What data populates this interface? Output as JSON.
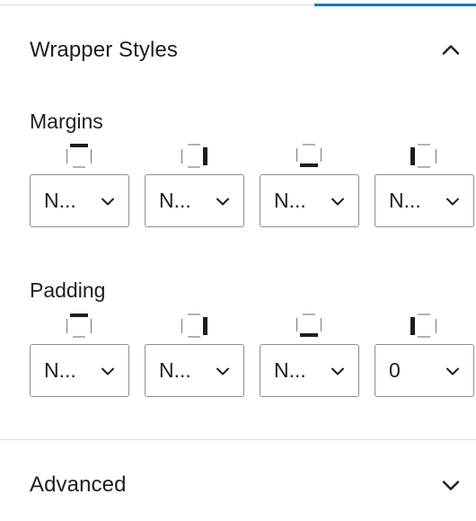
{
  "wrapper_styles": {
    "title": "Wrapper Styles",
    "expanded": true,
    "toggle_icon": "chevron-up-icon",
    "margins": {
      "label": "Margins",
      "fields": [
        {
          "side": "top",
          "icon": "box-top-side-icon",
          "value": "N..."
        },
        {
          "side": "right",
          "icon": "box-right-side-icon",
          "value": "N..."
        },
        {
          "side": "bottom",
          "icon": "box-bottom-side-icon",
          "value": "N..."
        },
        {
          "side": "left",
          "icon": "box-left-side-icon",
          "value": "N..."
        }
      ]
    },
    "padding": {
      "label": "Padding",
      "fields": [
        {
          "side": "top",
          "icon": "box-top-side-icon",
          "value": "N..."
        },
        {
          "side": "right",
          "icon": "box-right-side-icon",
          "value": "N..."
        },
        {
          "side": "bottom",
          "icon": "box-bottom-side-icon",
          "value": "N..."
        },
        {
          "side": "left",
          "icon": "box-left-side-icon",
          "value": "0"
        }
      ]
    }
  },
  "advanced": {
    "title": "Advanced",
    "expanded": false,
    "toggle_icon": "chevron-down-icon"
  },
  "colors": {
    "accent": "#007cba",
    "text": "#1e1e1e",
    "border": "#8c8f94",
    "divider": "#dcdcde"
  }
}
